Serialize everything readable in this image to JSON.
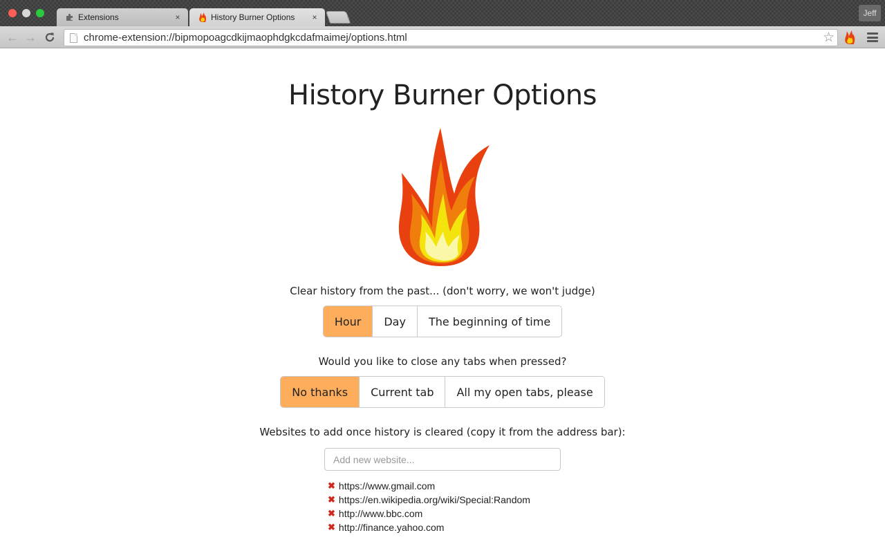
{
  "browser": {
    "tabs": [
      {
        "title": "Extensions",
        "icon": "puzzle-piece-icon",
        "active": false,
        "close": "×"
      },
      {
        "title": "History Burner Options",
        "icon": "flame-icon",
        "active": true,
        "close": "×"
      }
    ],
    "profile_name": "Jeff",
    "url": "chrome-extension://bipmopoagcdkijmaophdgkcdafmaimej/options.html",
    "nav": {
      "back": "←",
      "forward": "→",
      "reload": "C"
    },
    "bookmark_star": "☆"
  },
  "page": {
    "title": "History Burner Options",
    "clear_history": {
      "label": "Clear history from the past... (don't worry, we won't judge)",
      "options": [
        "Hour",
        "Day",
        "The beginning of time"
      ],
      "selected": "Hour"
    },
    "close_tabs": {
      "label": "Would you like to close any tabs when pressed?",
      "options": [
        "No thanks",
        "Current tab",
        "All my open tabs, please"
      ],
      "selected": "No thanks"
    },
    "websites": {
      "label": "Websites to add once history is cleared (copy it from the address bar):",
      "input_value": "",
      "placeholder": "Add new website...",
      "remove_glyph": "✖",
      "items": [
        "https://www.gmail.com",
        "https://en.wikipedia.org/wiki/Special:Random",
        "http://www.bbc.com",
        "http://finance.yahoo.com"
      ]
    }
  },
  "colors": {
    "accent_selected": "#fdad5c",
    "remove_red": "#d0281c",
    "flame_outer": "#e8410f",
    "flame_mid": "#f07e0c",
    "flame_inner": "#f2e40c",
    "flame_core": "#fbf7a8"
  }
}
